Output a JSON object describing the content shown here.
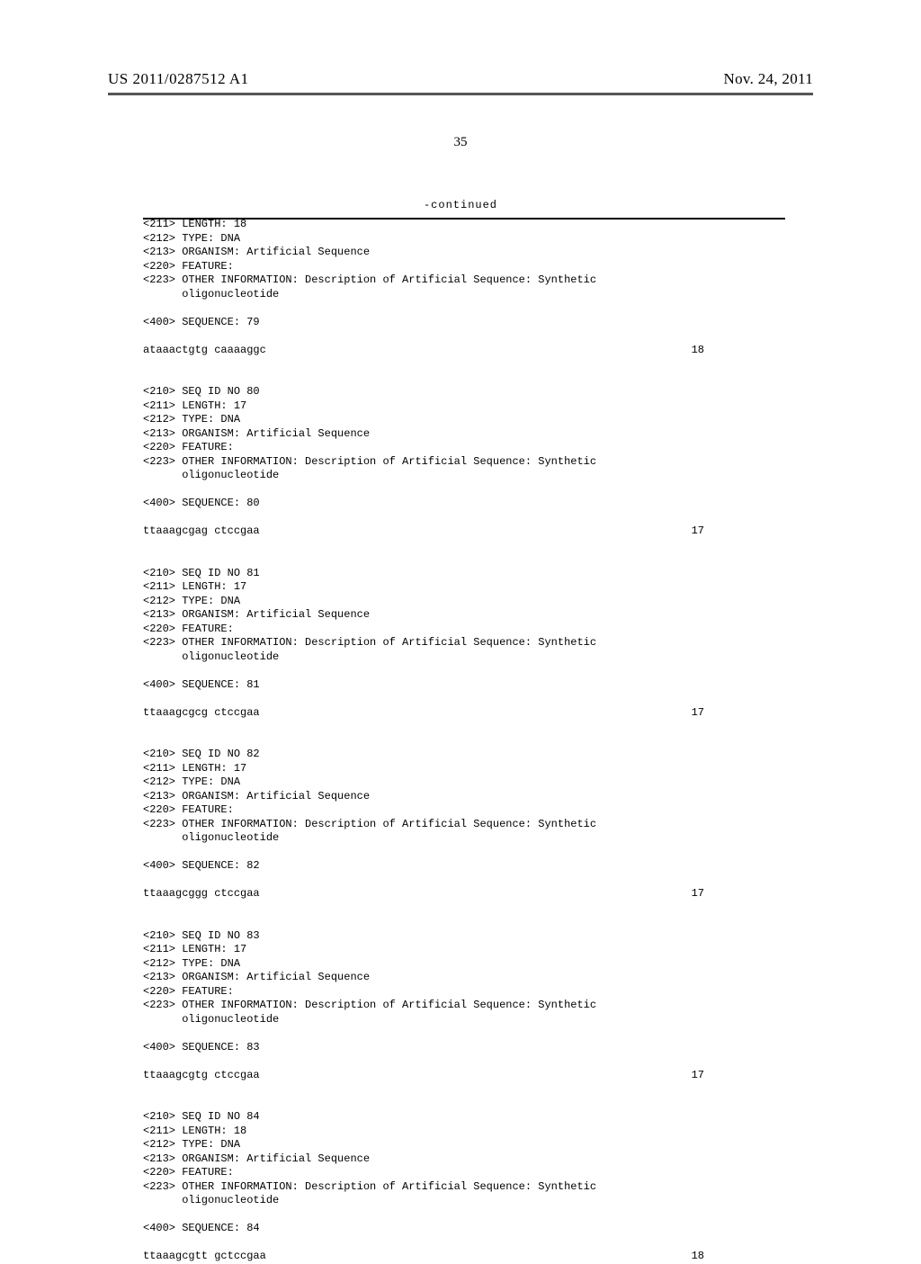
{
  "header": {
    "publication_number": "US 2011/0287512 A1",
    "publication_date": "Nov. 24, 2011"
  },
  "page_number": "35",
  "continued_label": "-continued",
  "sequences": [
    {
      "prefix_lines": [
        "<211> LENGTH: 18",
        "<212> TYPE: DNA",
        "<213> ORGANISM: Artificial Sequence",
        "<220> FEATURE:",
        "<223> OTHER INFORMATION: Description of Artificial Sequence: Synthetic",
        "      oligonucleotide"
      ],
      "sequence_header": "<400> SEQUENCE: 79",
      "sequence_line": "ataaactgtg caaaaggc",
      "sequence_length": "18"
    },
    {
      "prefix_lines": [
        "<210> SEQ ID NO 80",
        "<211> LENGTH: 17",
        "<212> TYPE: DNA",
        "<213> ORGANISM: Artificial Sequence",
        "<220> FEATURE:",
        "<223> OTHER INFORMATION: Description of Artificial Sequence: Synthetic",
        "      oligonucleotide"
      ],
      "sequence_header": "<400> SEQUENCE: 80",
      "sequence_line": "ttaaagcgag ctccgaa",
      "sequence_length": "17"
    },
    {
      "prefix_lines": [
        "<210> SEQ ID NO 81",
        "<211> LENGTH: 17",
        "<212> TYPE: DNA",
        "<213> ORGANISM: Artificial Sequence",
        "<220> FEATURE:",
        "<223> OTHER INFORMATION: Description of Artificial Sequence: Synthetic",
        "      oligonucleotide"
      ],
      "sequence_header": "<400> SEQUENCE: 81",
      "sequence_line": "ttaaagcgcg ctccgaa",
      "sequence_length": "17"
    },
    {
      "prefix_lines": [
        "<210> SEQ ID NO 82",
        "<211> LENGTH: 17",
        "<212> TYPE: DNA",
        "<213> ORGANISM: Artificial Sequence",
        "<220> FEATURE:",
        "<223> OTHER INFORMATION: Description of Artificial Sequence: Synthetic",
        "      oligonucleotide"
      ],
      "sequence_header": "<400> SEQUENCE: 82",
      "sequence_line": "ttaaagcggg ctccgaa",
      "sequence_length": "17"
    },
    {
      "prefix_lines": [
        "<210> SEQ ID NO 83",
        "<211> LENGTH: 17",
        "<212> TYPE: DNA",
        "<213> ORGANISM: Artificial Sequence",
        "<220> FEATURE:",
        "<223> OTHER INFORMATION: Description of Artificial Sequence: Synthetic",
        "      oligonucleotide"
      ],
      "sequence_header": "<400> SEQUENCE: 83",
      "sequence_line": "ttaaagcgtg ctccgaa",
      "sequence_length": "17"
    },
    {
      "prefix_lines": [
        "<210> SEQ ID NO 84",
        "<211> LENGTH: 18",
        "<212> TYPE: DNA",
        "<213> ORGANISM: Artificial Sequence",
        "<220> FEATURE:",
        "<223> OTHER INFORMATION: Description of Artificial Sequence: Synthetic",
        "      oligonucleotide"
      ],
      "sequence_header": "<400> SEQUENCE: 84",
      "sequence_line": "ttaaagcgtt gctccgaa",
      "sequence_length": "18"
    }
  ]
}
